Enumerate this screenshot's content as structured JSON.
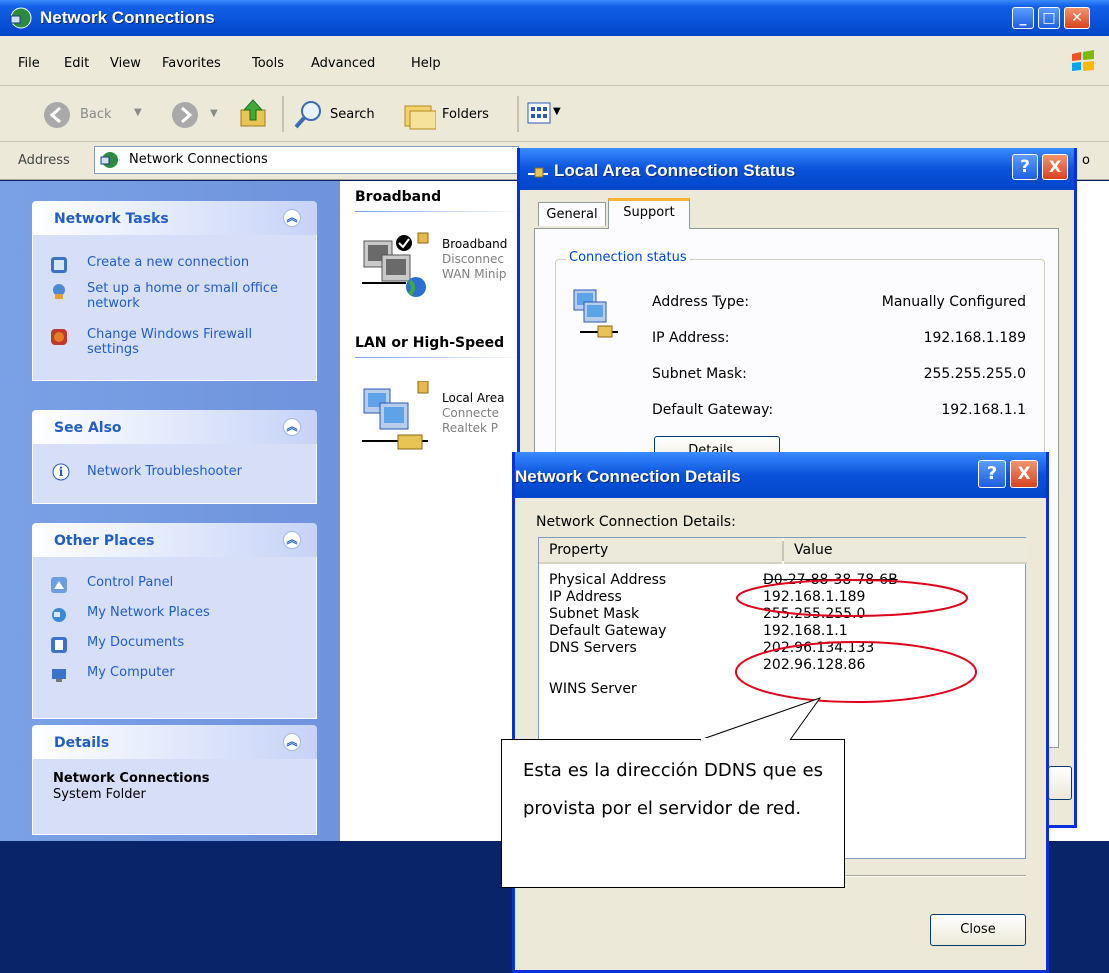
{
  "main_window": {
    "title": "Network Connections",
    "menu": [
      "File",
      "Edit",
      "View",
      "Favorites",
      "Tools",
      "Advanced",
      "Help"
    ],
    "toolbar": {
      "back": "Back",
      "search": "Search",
      "folders": "Folders"
    },
    "address": {
      "label": "Address",
      "value": "Network Connections",
      "go_fragment": "o"
    }
  },
  "sidebar": {
    "network_tasks": {
      "title": "Network Tasks",
      "items": [
        "Create a new connection",
        "Set up a home or small office network",
        "Change Windows Firewall settings"
      ]
    },
    "see_also": {
      "title": "See Also",
      "items": [
        "Network Troubleshooter"
      ]
    },
    "other_places": {
      "title": "Other Places",
      "items": [
        "Control Panel",
        "My Network Places",
        "My Documents",
        "My Computer"
      ]
    },
    "details": {
      "title": "Details",
      "name": "Network Connections",
      "type": "System Folder"
    }
  },
  "content": {
    "group_broadband": "Broadband",
    "broadband_conn": {
      "name": "Broadband",
      "status": "Disconnec",
      "device": "WAN Minip"
    },
    "group_lan": "LAN or High-Speed",
    "lan_conn": {
      "name": "Local Area",
      "status": "Connecte",
      "device": "Realtek P"
    }
  },
  "status_dialog": {
    "title": "Local Area Connection Status",
    "tabs": [
      "General",
      "Support"
    ],
    "group_label": "Connection status",
    "fields": [
      {
        "label": "Address Type:",
        "value": "Manually Configured"
      },
      {
        "label": "IP Address:",
        "value": "192.168.1.189"
      },
      {
        "label": "Subnet Mask:",
        "value": "255.255.255.0"
      },
      {
        "label": "Default Gateway:",
        "value": "192.168.1.1"
      }
    ],
    "details_button": "Details..."
  },
  "details_dialog": {
    "title": "Network Connection Details",
    "list_label": "Network Connection Details:",
    "columns": [
      "Property",
      "Value"
    ],
    "rows": [
      {
        "property": "Physical Address",
        "value": "D0-27-88-38-78-6B"
      },
      {
        "property": "IP Address",
        "value": "192.168.1.189"
      },
      {
        "property": "Subnet Mask",
        "value": "255.255.255.0"
      },
      {
        "property": "Default Gateway",
        "value": "192.168.1.1"
      },
      {
        "property": "DNS Servers",
        "value": "202.96.134.133"
      },
      {
        "property": "",
        "value": "202.96.128.86"
      },
      {
        "property": "WINS Server",
        "value": ""
      }
    ],
    "close_button": "Close",
    "help_glyph": "?",
    "close_glyph": "X"
  },
  "callout": {
    "text": "Esta es la dirección DDNS que es provista por el servidor de red."
  },
  "colors": {
    "titlebar": "#0a52da",
    "sidebar": "#7aa1e6",
    "link": "#215dc6",
    "annotation": "#e0001a"
  }
}
